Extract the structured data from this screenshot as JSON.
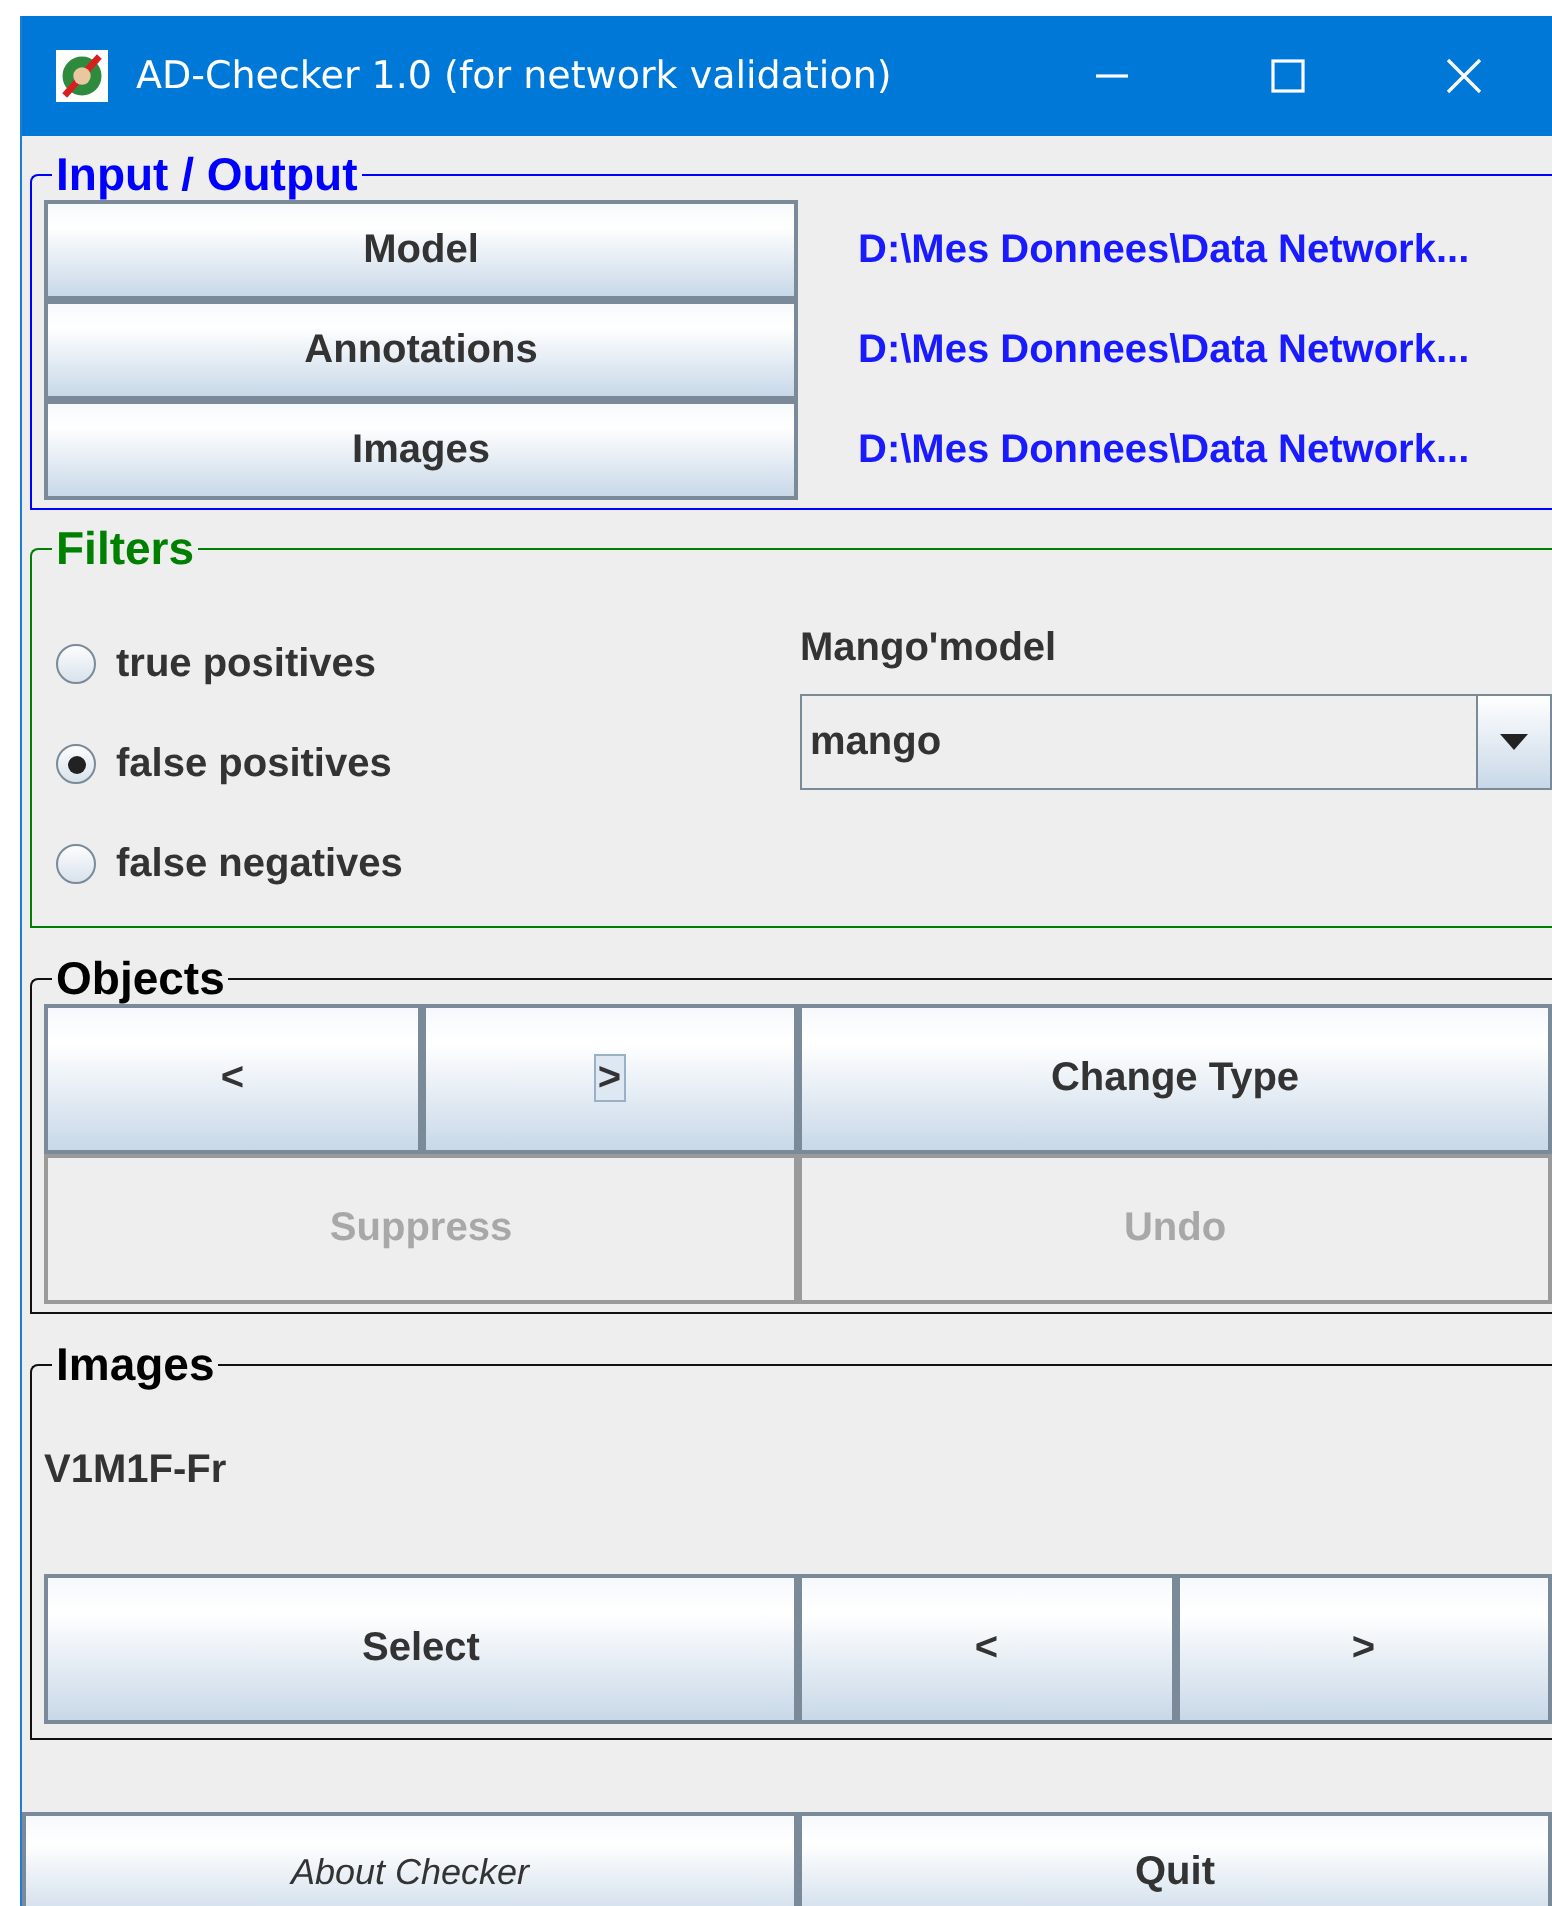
{
  "window": {
    "title": "AD-Checker 1.0 (for network validation)"
  },
  "input_output": {
    "title": "Input / Output",
    "rows": [
      {
        "button": "Model",
        "path": "D:\\Mes Donnees\\Data Network..."
      },
      {
        "button": "Annotations",
        "path": "D:\\Mes Donnees\\Data Network..."
      },
      {
        "button": "Images",
        "path": "D:\\Mes Donnees\\Data Network..."
      }
    ]
  },
  "filters": {
    "title": "Filters",
    "options": [
      {
        "label": "true positives",
        "selected": false
      },
      {
        "label": "false positives",
        "selected": true
      },
      {
        "label": "false negatives",
        "selected": false
      }
    ],
    "model_label": "Mango'model",
    "model_value": "mango"
  },
  "objects": {
    "title": "Objects",
    "rows": [
      {
        "buttons": [
          {
            "label": "<",
            "disabled": false,
            "focused": false
          },
          {
            "label": ">",
            "disabled": false,
            "focused": true
          },
          {
            "label": "Change Type",
            "disabled": false,
            "focused": false
          }
        ]
      },
      {
        "buttons": [
          {
            "label": "Suppress",
            "disabled": true,
            "focused": false
          },
          {
            "label": "Undo",
            "disabled": true,
            "focused": false
          }
        ]
      }
    ]
  },
  "images": {
    "title": "Images",
    "current": "V1M1F-Fr",
    "buttons": [
      {
        "label": "Select",
        "disabled": false,
        "focused": false
      },
      {
        "label": "<",
        "disabled": false,
        "focused": false
      },
      {
        "label": ">",
        "disabled": false,
        "focused": false
      }
    ]
  },
  "footer": {
    "buttons": [
      {
        "label": "About Checker",
        "italic": true
      },
      {
        "label": "Quit",
        "italic": false
      }
    ]
  }
}
